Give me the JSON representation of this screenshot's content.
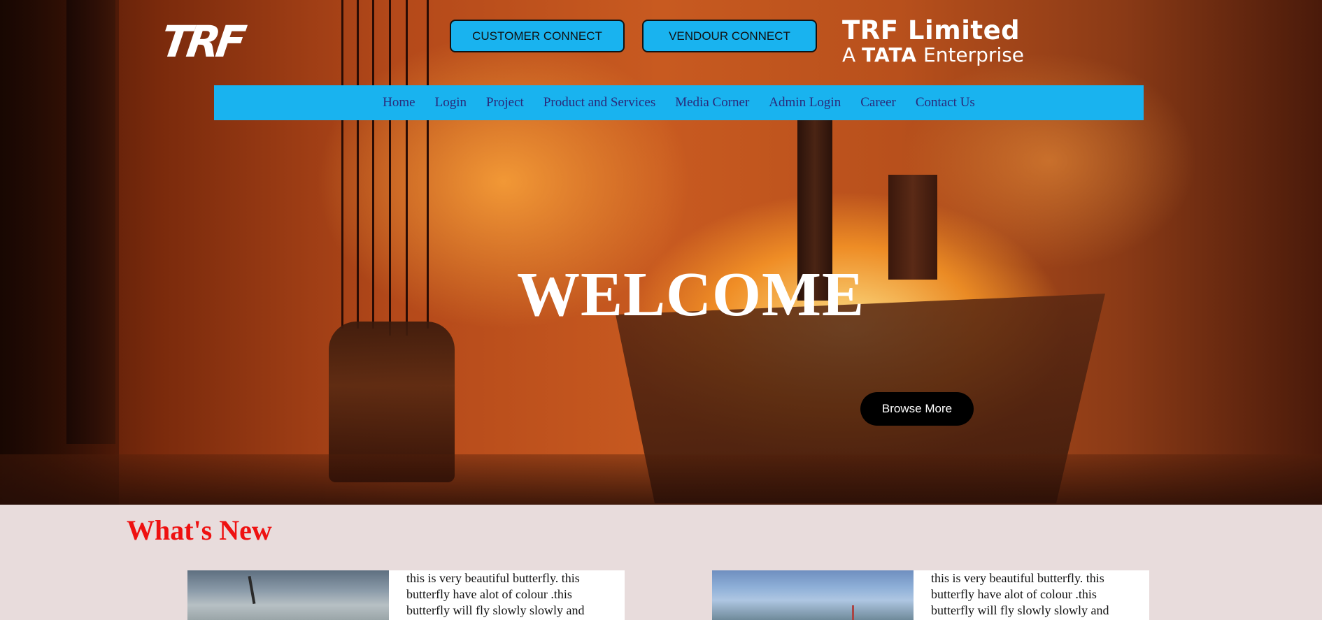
{
  "header": {
    "logo_text": "TRF",
    "customer_connect_label": "CUSTOMER CONNECT",
    "vendour_connect_label": "VENDOUR CONNECT",
    "brand_line1": "TRF Limited",
    "brand_line2_a": "A",
    "brand_line2_tata": "TATA",
    "brand_line2_b": "Enterprise"
  },
  "nav": {
    "items": [
      {
        "label": "Home"
      },
      {
        "label": "Login"
      },
      {
        "label": "Project"
      },
      {
        "label": "Product and Services"
      },
      {
        "label": "Media Corner"
      },
      {
        "label": "Admin Login"
      },
      {
        "label": "Career"
      },
      {
        "label": "Contact Us"
      }
    ]
  },
  "hero": {
    "title": "WELCOME",
    "browse_label": "Browse More"
  },
  "whats_new": {
    "heading": "What's New",
    "cards": [
      {
        "text": "this is very beautiful butterfly. this butterfly have alot of colour .this butterfly will fly slowly slowly and"
      },
      {
        "text": "this is very beautiful butterfly. this butterfly have alot of colour .this butterfly will fly slowly slowly and"
      }
    ]
  },
  "colors": {
    "accent": "#19b3ef",
    "heading_red": "#ee1111",
    "section_bg": "#e8dcdc",
    "nav_text": "#2a2a7a"
  }
}
